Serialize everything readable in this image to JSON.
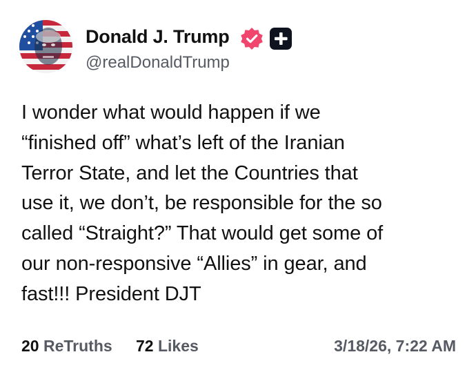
{
  "author": {
    "display_name": "Donald J. Trump",
    "handle": "@realDonaldTrump",
    "avatar": "flag-portrait-avatar",
    "verified_badge": "verified-check-icon",
    "plus_badge": "plus-icon",
    "verified_color": "#f0466e"
  },
  "post": {
    "lines": [
      "I wonder what would happen if we",
      "“finished off” what’s left of the Iranian",
      "Terror State, and let the Countries that",
      "use it, we don’t, be responsible for the so",
      "called “Straight?” That would get some of",
      "our non-responsive “Allies” in gear, and",
      "fast!!! President DJT"
    ]
  },
  "stats": {
    "retruths_count": "20",
    "retruths_label": "ReTruths",
    "likes_count": "72",
    "likes_label": "Likes"
  },
  "timestamp": "3/18/26, 7:22 AM"
}
